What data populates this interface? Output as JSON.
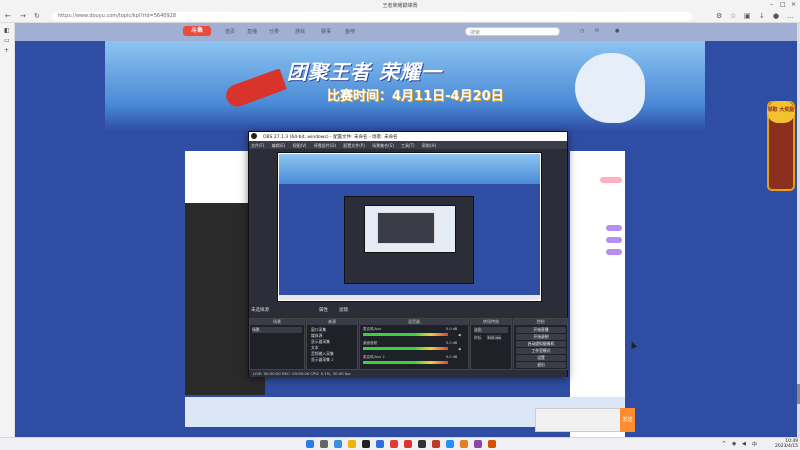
{
  "browser": {
    "window_title": "王者荣耀巅峰赛",
    "url": "https://www.douyu.com/topic/kpl?rid=5640928",
    "sidebar_icons": [
      "tab-icon",
      "page-icon",
      "add-icon"
    ]
  },
  "site": {
    "logo": "斗鱼",
    "nav": [
      "首页",
      "直播",
      "分类",
      "游戏",
      "赛事",
      "鱼吧"
    ],
    "search_placeholder": "搜索",
    "banner_title": "团聚王者 荣耀一",
    "banner_date": "比赛时间：4月11日-4月20日",
    "coupon_text": "领取 大奖励",
    "send_label": "发送"
  },
  "obs": {
    "title": "OBS 27.1.3 (64-bit, windows) - 配置文件: 未命名 - 场景: 未命名",
    "menu": [
      "文件(F)",
      "编辑(E)",
      "视图(V)",
      "停靠部件(D)",
      "配置文件(P)",
      "场景集合(S)",
      "工具(T)",
      "帮助(H)"
    ],
    "toolbar": [
      "未选择源",
      "属性",
      "滤镜"
    ],
    "docks": {
      "scenes": "场景",
      "sources": "来源",
      "mixer": "混音器",
      "transitions": "转场特效",
      "controls": "控制"
    },
    "scene_items": [
      "场景"
    ],
    "source_items": [
      "窗口采集",
      "媒体源",
      "显示器采集",
      "文本",
      "音频输入采集",
      "显示器采集 2"
    ],
    "mixer_tracks": [
      {
        "name": "麦克风/Aux",
        "value": "0.0 dB"
      },
      {
        "name": "桌面音频",
        "value": "0.0 dB"
      },
      {
        "name": "麦克风/Aux 2",
        "value": "0.0 dB"
      }
    ],
    "transition": {
      "name": "淡出",
      "duration_label": "时长",
      "duration": "300 ms"
    },
    "controls": [
      "开始直播",
      "开始录制",
      "启动虚拟摄像机",
      "工作室模式",
      "设置",
      "退出"
    ],
    "status": "LIVE: 00:00:00   REC: 00:00:00   CPU: 5.1%, 30.00 fps"
  },
  "taskbar": {
    "time": "10:49",
    "date": "2023/4/15"
  }
}
